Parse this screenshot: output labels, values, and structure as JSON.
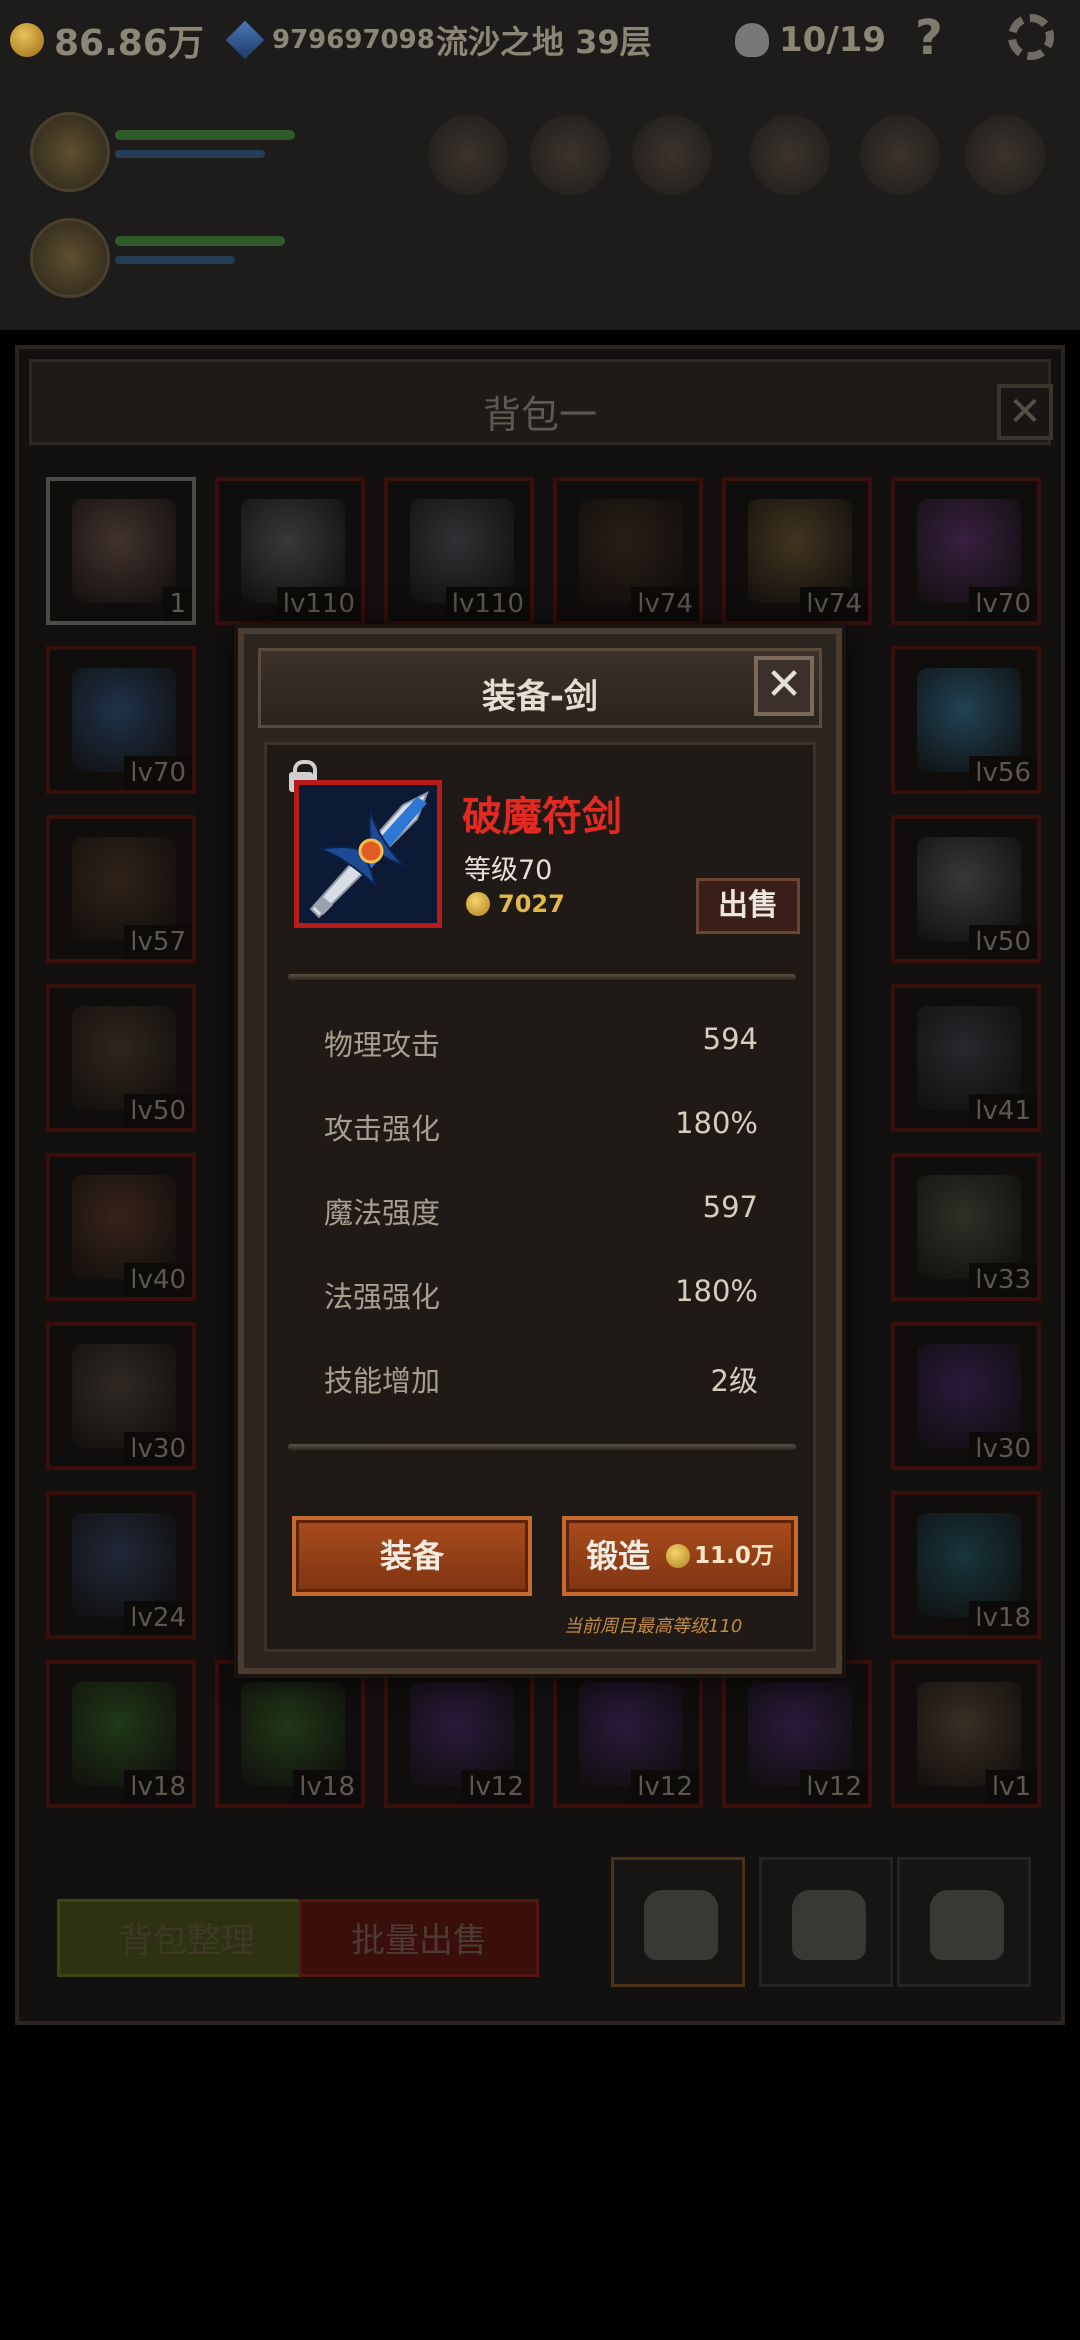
{
  "hud": {
    "gold": "86.86万",
    "gems": "979697098",
    "location": "流沙之地 39层",
    "kills": "10/19",
    "help": "?"
  },
  "backpack": {
    "title": "背包一",
    "close": "✕",
    "items": [
      {
        "label": "1",
        "icon": "cake-icon",
        "color": "#6b5048",
        "rarity": "white"
      },
      {
        "label": "lv110",
        "icon": "hammer-icon",
        "color": "#5a5a5c",
        "rarity": "red"
      },
      {
        "label": "lv110",
        "icon": "scythe-blade-icon",
        "color": "#4c4c55",
        "rarity": "red"
      },
      {
        "label": "lv74",
        "icon": "hood-icon",
        "color": "#3b2b1e",
        "rarity": "red"
      },
      {
        "label": "lv74",
        "icon": "helmet-icon",
        "color": "#6a5331",
        "rarity": "red"
      },
      {
        "label": "lv70",
        "icon": "pistol-icon",
        "color": "#5a2f6a",
        "rarity": "red"
      },
      {
        "label": "lv70",
        "icon": "sword-icon",
        "color": "#2c4f7a",
        "rarity": "red"
      },
      {
        "label": "lv56",
        "icon": "orb-icon",
        "color": "#2e6d8d",
        "rarity": "red",
        "col": 5
      },
      {
        "label": "lv57",
        "icon": "bow-icon",
        "color": "#4b3522",
        "rarity": "red"
      },
      {
        "label": "lv50",
        "icon": "hammer-icon",
        "color": "#5a5a5c",
        "rarity": "red",
        "col": 5
      },
      {
        "label": "lv50",
        "icon": "dagger-icon",
        "color": "#4a3a2a",
        "rarity": "red"
      },
      {
        "label": "lv41",
        "icon": "helmet-icon",
        "color": "#3a3f48",
        "rarity": "red",
        "col": 5
      },
      {
        "label": "lv40",
        "icon": "trident-icon",
        "color": "#5a3526",
        "rarity": "red"
      },
      {
        "label": "lv33",
        "icon": "gauntlet-icon",
        "color": "#4b4b3c",
        "rarity": "red",
        "col": 5
      },
      {
        "label": "lv30",
        "icon": "hammer-icon",
        "color": "#4a4036",
        "rarity": "red"
      },
      {
        "label": "lv30",
        "icon": "amulet-icon",
        "color": "#3c2560",
        "rarity": "red",
        "col": 5
      },
      {
        "label": "lv24",
        "icon": "boots-icon",
        "color": "#2e3d5e",
        "rarity": "red"
      },
      {
        "label": "lv18",
        "icon": "necklace-icon",
        "color": "#1e5564",
        "rarity": "red",
        "col": 5
      },
      {
        "label": "lv18",
        "icon": "cloak-icon",
        "color": "#2d5a22",
        "rarity": "red"
      },
      {
        "label": "lv18",
        "icon": "cloak-icon",
        "color": "#2d5a22",
        "rarity": "red"
      },
      {
        "label": "lv12",
        "icon": "amulet-icon",
        "color": "#3c2560",
        "rarity": "red"
      },
      {
        "label": "lv12",
        "icon": "amulet-icon",
        "color": "#3c2560",
        "rarity": "red"
      },
      {
        "label": "lv12",
        "icon": "amulet-icon",
        "color": "#3c2560",
        "rarity": "red"
      },
      {
        "label": "lv1",
        "icon": "shield-icon",
        "color": "#5a4a36",
        "rarity": "red"
      }
    ],
    "sort_button": "背包整理",
    "bulk_sell_button": "批量出售"
  },
  "modal": {
    "title": "装备-剑",
    "close": "✕",
    "item": {
      "name": "破魔符剑",
      "level": "等级70",
      "price": "7027",
      "sell": "出售"
    },
    "stats": [
      {
        "name": "物理攻击",
        "value": "594"
      },
      {
        "name": "攻击强化",
        "value": "180%"
      },
      {
        "name": "魔法强度",
        "value": "597"
      },
      {
        "name": "法强强化",
        "value": "180%"
      },
      {
        "name": "技能增加",
        "value": "2级"
      }
    ],
    "equip_button": "装备",
    "forge_button": "锻造",
    "forge_cost": "11.0万",
    "note": "当前周目最高等级110"
  }
}
